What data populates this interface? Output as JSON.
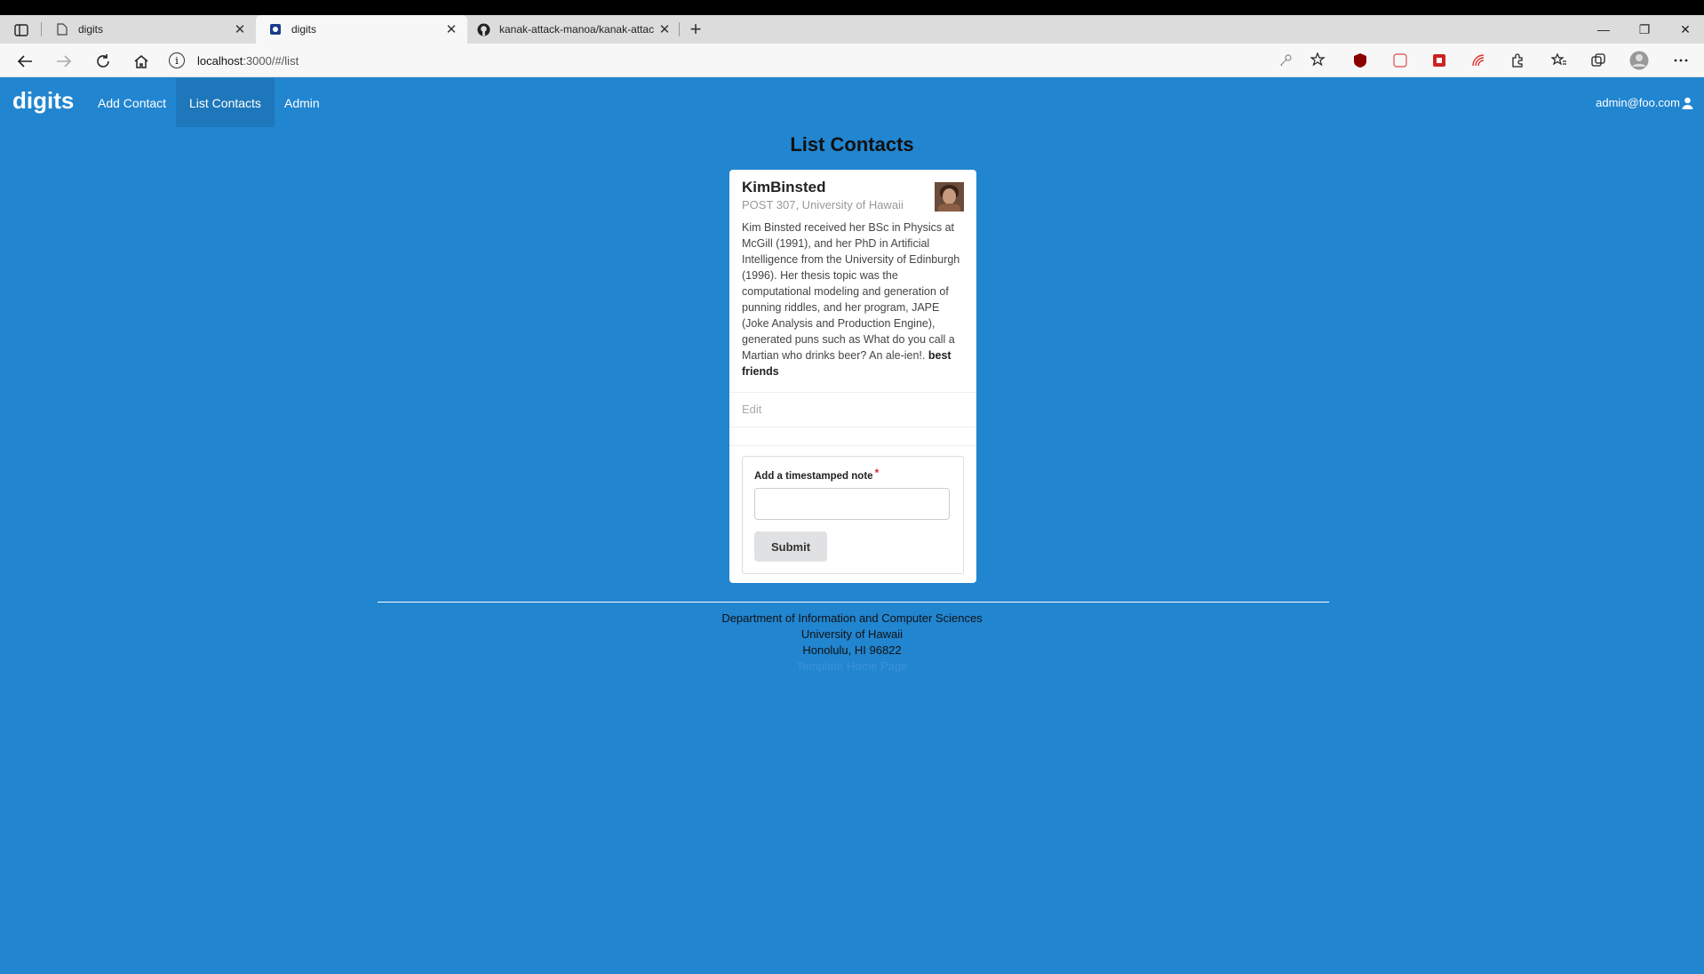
{
  "browser": {
    "tabs": [
      {
        "title": "digits",
        "active": false
      },
      {
        "title": "digits",
        "active": true
      },
      {
        "title": "kanak-attack-manoa/kanak-attac",
        "active": false
      }
    ],
    "url_host": "localhost",
    "url_rest": ":3000/#/list",
    "close_symbol": "✕",
    "new_tab_symbol": "+",
    "window_controls": [
      "—",
      "❐",
      "✕"
    ]
  },
  "app": {
    "brand": "digits",
    "nav": [
      {
        "label": "Add Contact",
        "active": false
      },
      {
        "label": "List Contacts",
        "active": true
      },
      {
        "label": "Admin",
        "active": false
      }
    ],
    "user": "admin@foo.com"
  },
  "page": {
    "title": "List Contacts"
  },
  "contact": {
    "name": "KimBinsted",
    "address": "POST 307, University of Hawaii",
    "description": "Kim Binsted received her BSc in Physics at McGill (1991), and her PhD in Artificial Intelligence from the University of Edinburgh (1996). Her thesis topic was the computational modeling and generation of punning riddles, and her program, JAPE (Joke Analysis and Production Engine), generated puns such as What do you call a Martian who drinks beer? An ale-ien!.",
    "note": "best friends",
    "edit_label": "Edit",
    "form": {
      "label": "Add a timestamped note",
      "required_mark": "*",
      "input_value": "",
      "submit_label": "Submit"
    }
  },
  "footer": {
    "line1": "Department of Information and Computer Sciences",
    "line2": "University of Hawaii",
    "line3": "Honolulu, HI 96822",
    "line4": "Template Home Page"
  },
  "colors": {
    "background": "#2185d0",
    "card": "#ffffff",
    "required": "#db2828"
  }
}
